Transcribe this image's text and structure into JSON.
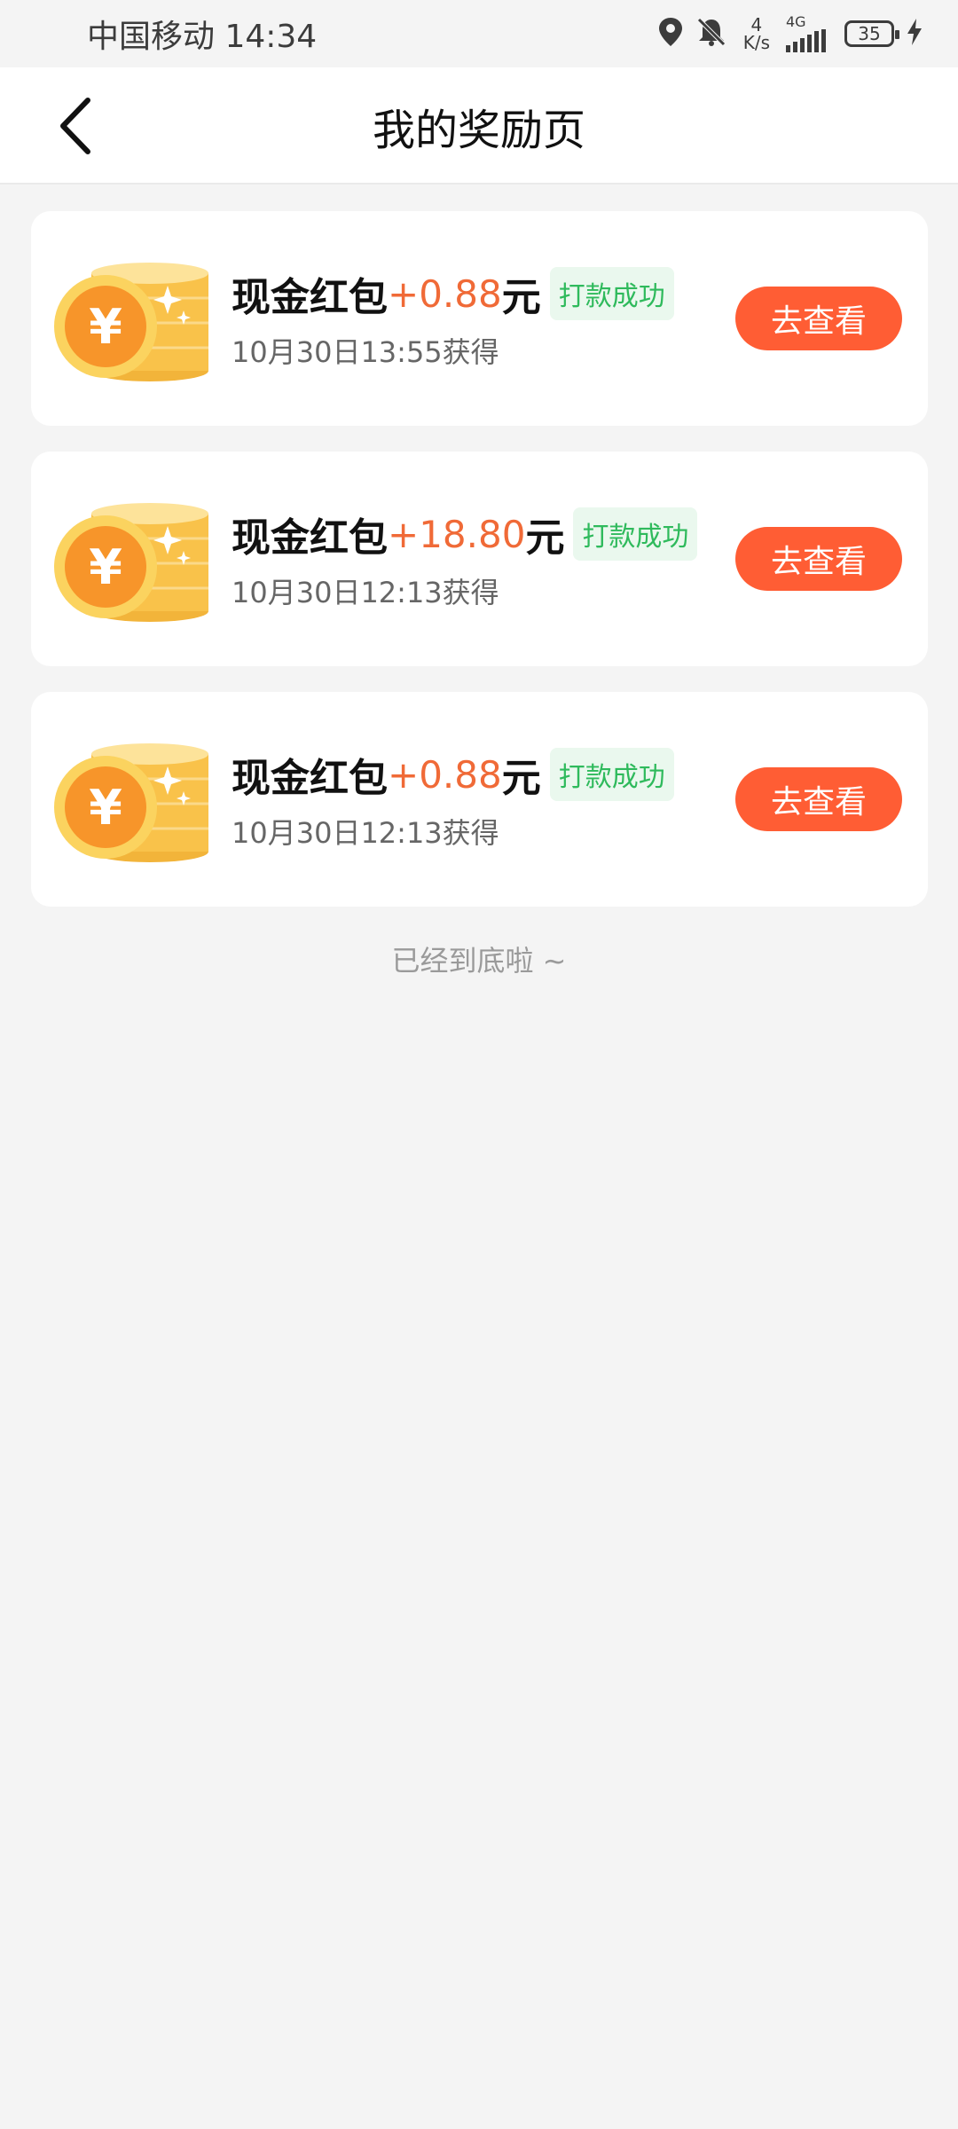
{
  "status_bar": {
    "carrier_time": "中国移动 14:34",
    "net_speed_value": "4",
    "net_speed_unit": "K/s",
    "network_type": "4G",
    "battery": "35"
  },
  "header": {
    "title": "我的奖励页"
  },
  "rewards": [
    {
      "prefix": "现金红包",
      "amount": "+0.88",
      "unit": "元",
      "status": "打款成功",
      "time": "10月30日13:55获得",
      "button": "去查看"
    },
    {
      "prefix": "现金红包",
      "amount": "+18.80",
      "unit": "元",
      "status": "打款成功",
      "time": "10月30日12:13获得",
      "button": "去查看"
    },
    {
      "prefix": "现金红包",
      "amount": "+0.88",
      "unit": "元",
      "status": "打款成功",
      "time": "10月30日12:13获得",
      "button": "去查看"
    }
  ],
  "footer": {
    "end_text": "已经到底啦 ~"
  },
  "colors": {
    "accent": "#ff5d34",
    "amount": "#f06a37",
    "success": "#2fba5c",
    "coin": "#f8b52d"
  },
  "icons": {
    "back": "chevron-left-icon",
    "location": "location-pin-icon",
    "mute": "bell-off-icon",
    "signal": "signal-bars-icon",
    "charging": "lightning-icon",
    "reward": "coin-stack-icon"
  }
}
